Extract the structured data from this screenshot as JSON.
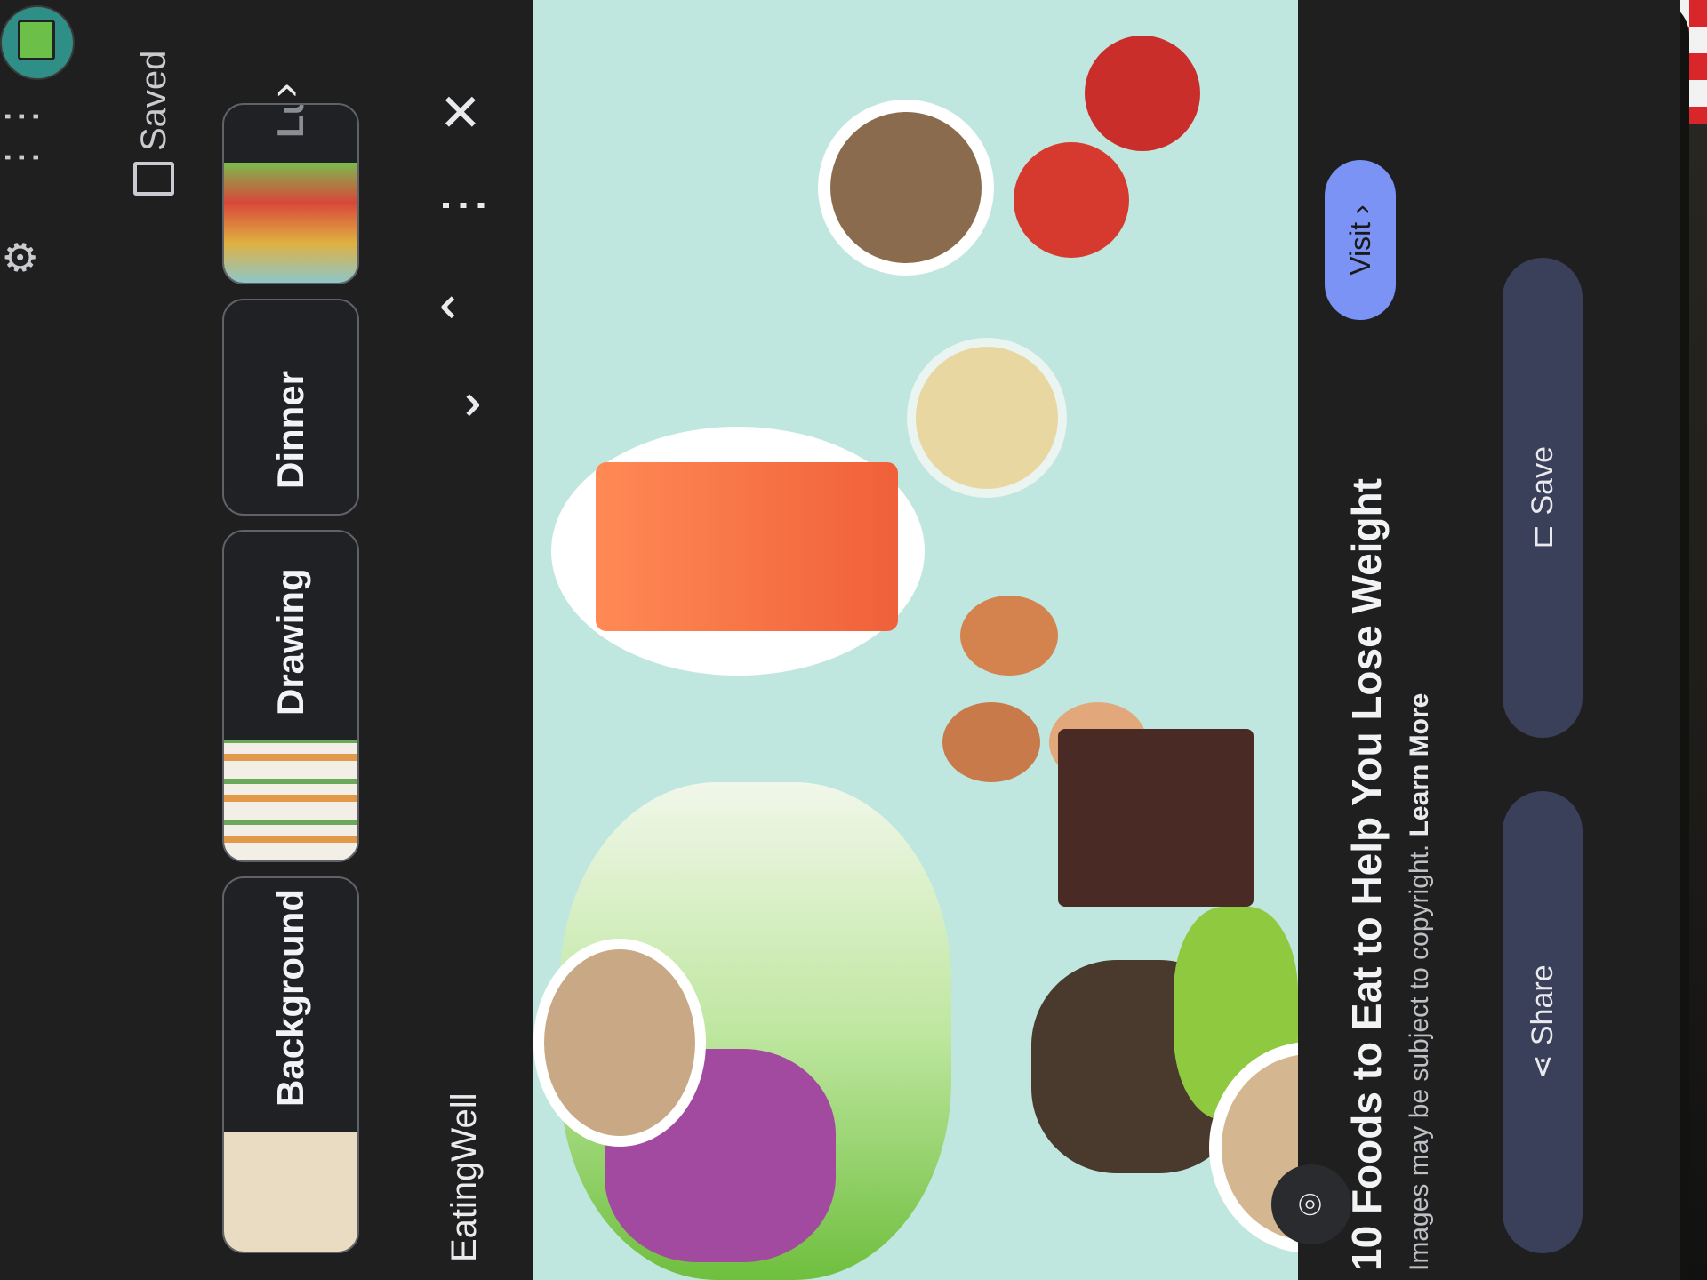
{
  "topbar": {
    "saved_label": "Saved",
    "icons": [
      "settings-icon",
      "apps-grid-icon",
      "saved-icon",
      "avatar"
    ]
  },
  "chips": [
    {
      "label": "Background"
    },
    {
      "label": "Drawing"
    },
    {
      "label": "Dinner"
    },
    {
      "label": "Lu"
    }
  ],
  "source": {
    "name": "EatingWell"
  },
  "result": {
    "title": "10 Foods to Eat to Help You Lose Weight",
    "copyright": "Images may be subject to copyright.",
    "learn_more": "Learn More",
    "visit_label": "Visit",
    "save_label": "Save",
    "share_label": "Share"
  },
  "colors": {
    "accent": "#7b93f5",
    "background": "#1f1f1f",
    "image_bg": "#bfe7df"
  }
}
